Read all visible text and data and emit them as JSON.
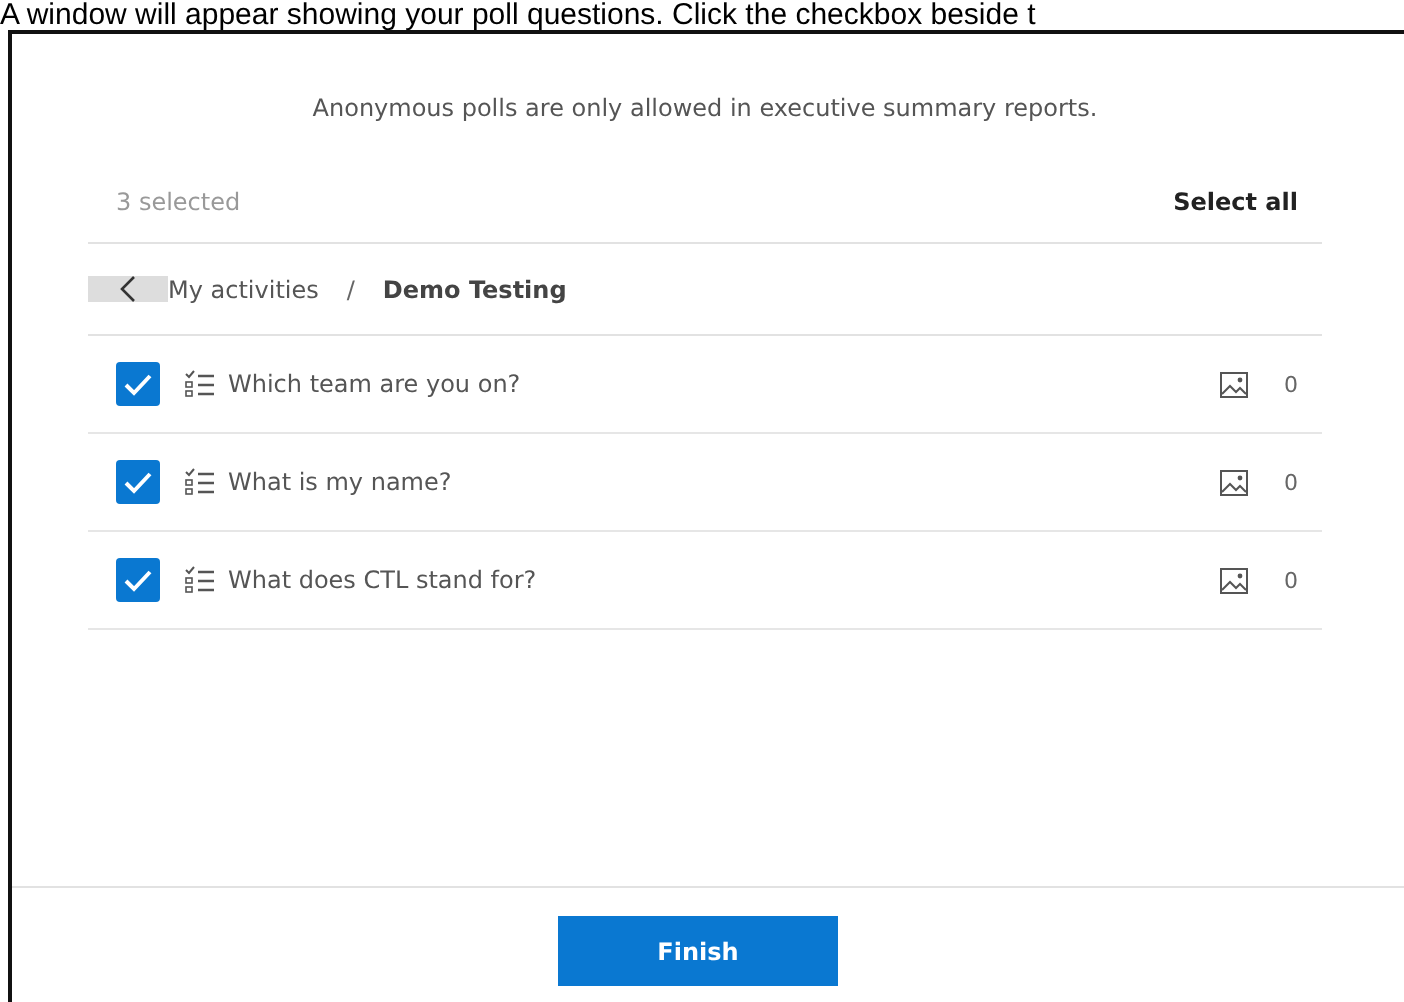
{
  "instruction": "A window will appear showing your poll questions. Click the checkbox beside t",
  "notice": "Anonymous polls are only allowed in executive summary reports.",
  "selection": {
    "count_label": "3 selected",
    "select_all": "Select all"
  },
  "breadcrumb": {
    "parent": "My activities",
    "separator": "/",
    "current": "Demo Testing"
  },
  "questions": [
    {
      "title": "Which team are you on?",
      "checked": true,
      "count": "0"
    },
    {
      "title": "What is my name?",
      "checked": true,
      "count": "0"
    },
    {
      "title": "What does CTL stand for?",
      "checked": true,
      "count": "0"
    }
  ],
  "finish_button": "Finish"
}
